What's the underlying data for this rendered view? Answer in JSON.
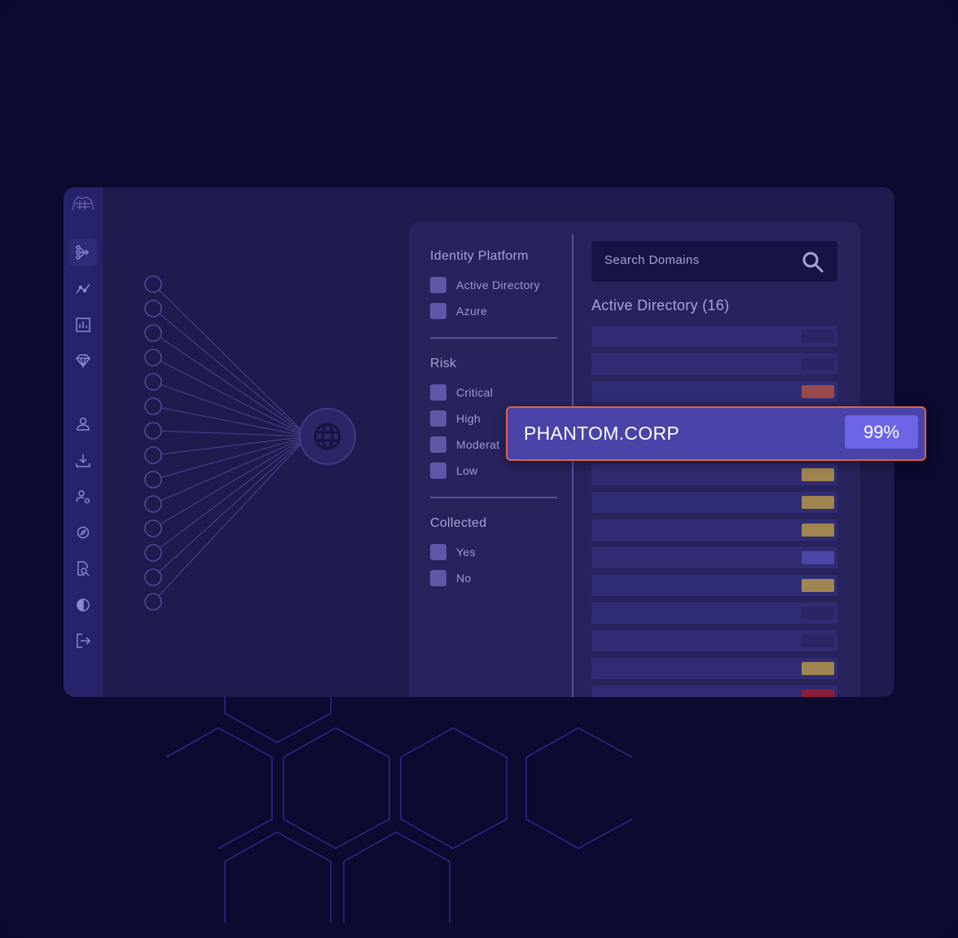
{
  "colors": {
    "background": "#0b0a2f",
    "window": "#1f1b4f",
    "sidebar": "#27236a",
    "accent_border": "#e0614c",
    "highlight": "#4a43a8",
    "score_badge": "#6d64e8"
  },
  "sidebar": {
    "logo_icon": "lion-logo-icon",
    "icons": [
      "graph-branch-icon",
      "line-chart-icon",
      "bar-chart-icon",
      "diamond-icon",
      "user-icon",
      "download-icon",
      "user-settings-icon",
      "compass-icon",
      "file-search-icon",
      "contrast-icon",
      "logout-icon"
    ],
    "active_index": 0
  },
  "filters": {
    "identity_platform": {
      "title": "Identity Platform",
      "options": [
        "Active Directory",
        "Azure"
      ]
    },
    "risk": {
      "title": "Risk",
      "options": [
        "Critical",
        "High",
        "Moderat",
        "Low"
      ]
    },
    "collected": {
      "title": "Collected",
      "options": [
        "Yes",
        "No"
      ]
    }
  },
  "search": {
    "placeholder": "Search Domains",
    "icon": "search-icon"
  },
  "domain_list": {
    "title": "Active Directory (16)",
    "row_chip_colors": [
      "#2a2666",
      "#2a2666",
      "#9a4a4c",
      "#9f8550",
      "#9f8550",
      "#9f8550",
      "#4c46a8",
      "#9f8550",
      "#2a2666",
      "#2a2666",
      "#9f8550",
      "#8a1f3a"
    ]
  },
  "highlight": {
    "name": "PHANTOM.CORP",
    "score": "99%"
  }
}
